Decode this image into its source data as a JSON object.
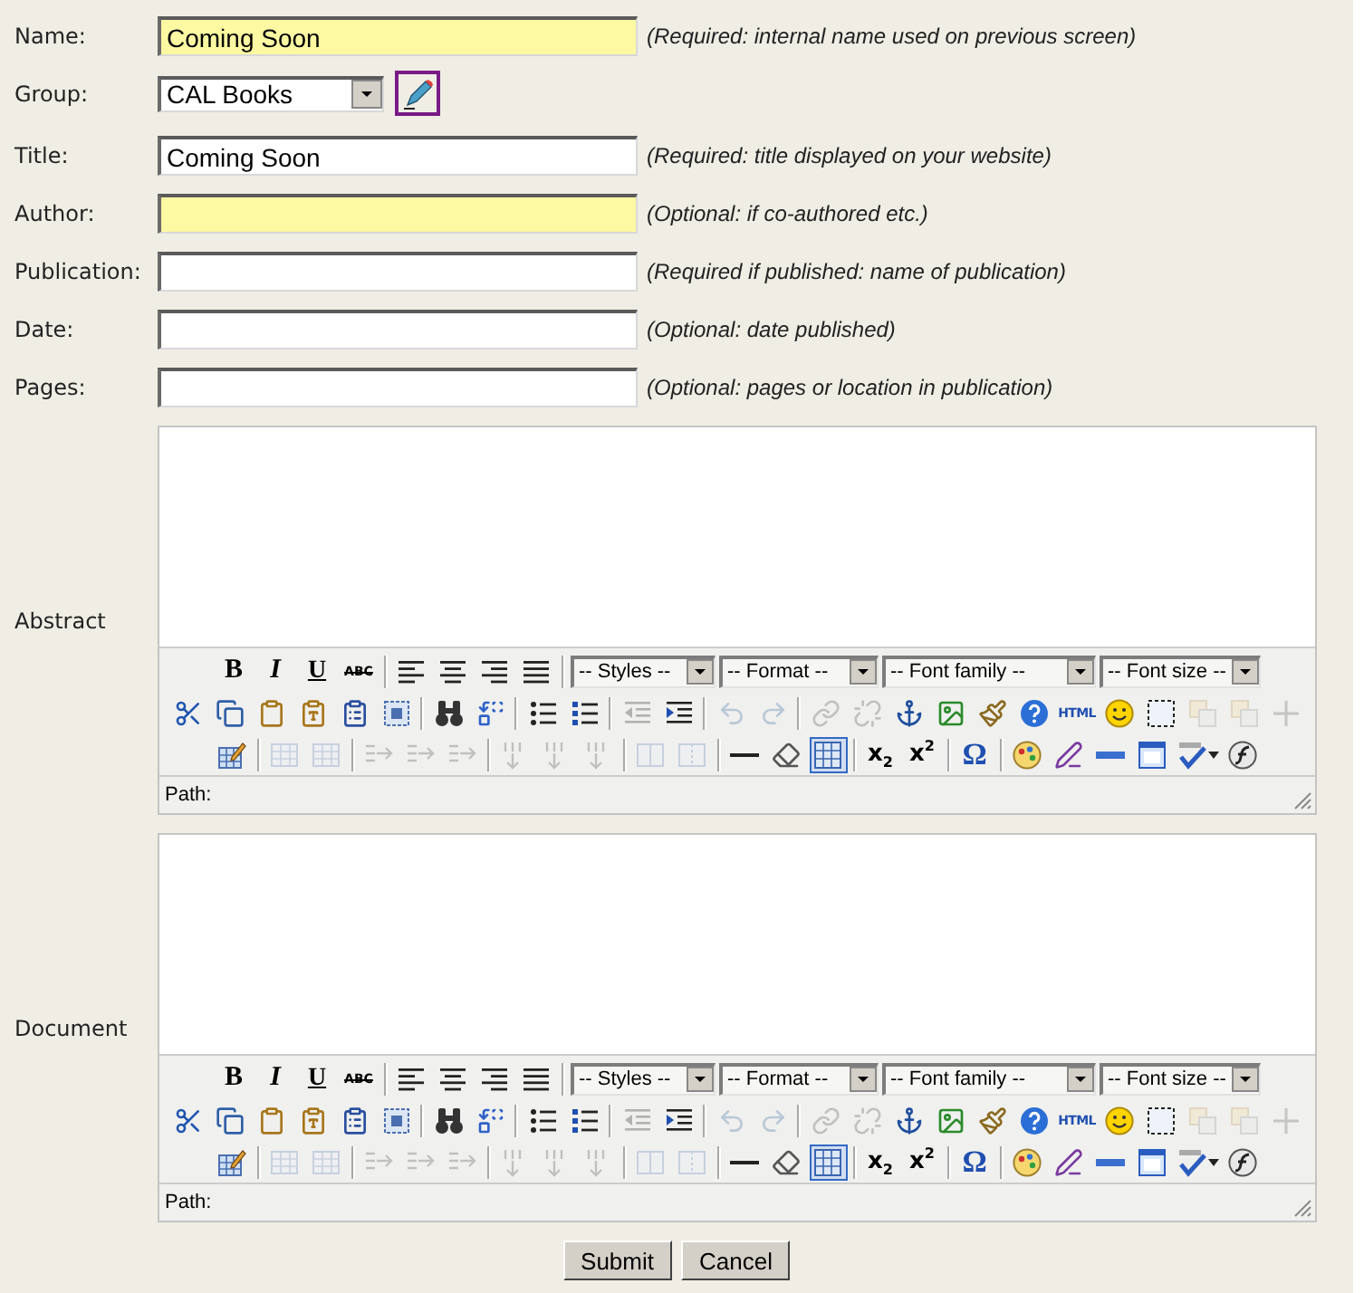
{
  "fields": [
    {
      "kind": "text",
      "label": "Name:",
      "value": "Coming Soon",
      "highlighted": true,
      "hint": "(Required: internal name used on previous screen)"
    },
    {
      "kind": "select",
      "label": "Group:",
      "value": "CAL Books"
    },
    {
      "kind": "text",
      "label": "Title:",
      "value": "Coming Soon",
      "highlighted": false,
      "hint": "(Required: title displayed on your website)"
    },
    {
      "kind": "text",
      "label": "Author:",
      "highlighted": true,
      "hint": "(Optional: if co-authored etc.)"
    },
    {
      "kind": "text",
      "label": "Publication:",
      "highlighted": false,
      "hint": "(Required if published: name of publication)"
    },
    {
      "kind": "text",
      "label": "Date:",
      "highlighted": false,
      "hint": "(Optional: date published)"
    },
    {
      "kind": "text",
      "label": "Pages:",
      "highlighted": false,
      "hint": "(Optional: pages or location in publication)"
    }
  ],
  "editors": [
    {
      "label": "Abstract",
      "toolbar": [
        [
          {
            "kind": "glyph",
            "text": "B",
            "disabled": false,
            "active": false
          },
          {
            "kind": "glyph",
            "text": "I",
            "disabled": false,
            "active": false
          },
          {
            "kind": "glyph",
            "text": "U",
            "disabled": false,
            "active": false
          },
          {
            "kind": "glyph",
            "text": "ABC",
            "disabled": false,
            "active": false
          },
          {
            "kind": "separator"
          },
          {
            "kind": "icon",
            "disabled": false,
            "active": false
          },
          {
            "kind": "icon",
            "disabled": false,
            "active": false
          },
          {
            "kind": "icon",
            "disabled": false,
            "active": false
          },
          {
            "kind": "icon",
            "disabled": false,
            "active": false
          },
          {
            "kind": "separator"
          },
          {
            "kind": "dropdown",
            "text": "-- Styles --"
          },
          {
            "kind": "dropdown",
            "text": "-- Format --"
          },
          {
            "kind": "dropdown",
            "text": "-- Font family --"
          },
          {
            "kind": "dropdown",
            "text": "-- Font size --"
          }
        ],
        [
          {
            "kind": "icon",
            "disabled": false,
            "active": false
          },
          {
            "kind": "icon",
            "disabled": false,
            "active": false
          },
          {
            "kind": "icon",
            "disabled": false,
            "active": false
          },
          {
            "kind": "icon",
            "disabled": false,
            "active": false
          },
          {
            "kind": "icon",
            "disabled": false,
            "active": false
          },
          {
            "kind": "icon",
            "disabled": false,
            "active": false
          },
          {
            "kind": "separator"
          },
          {
            "kind": "icon",
            "disabled": false,
            "active": false
          },
          {
            "kind": "icon",
            "disabled": false,
            "active": false
          },
          {
            "kind": "separator"
          },
          {
            "kind": "icon",
            "disabled": false,
            "active": false
          },
          {
            "kind": "icon",
            "disabled": false,
            "active": false
          },
          {
            "kind": "separator"
          },
          {
            "kind": "icon",
            "disabled": true,
            "active": false
          },
          {
            "kind": "icon",
            "disabled": false,
            "active": false
          },
          {
            "kind": "separator"
          },
          {
            "kind": "icon",
            "disabled": true,
            "active": false
          },
          {
            "kind": "icon",
            "disabled": true,
            "active": false
          },
          {
            "kind": "separator"
          },
          {
            "kind": "icon",
            "disabled": true,
            "active": false
          },
          {
            "kind": "icon",
            "disabled": true,
            "active": false
          },
          {
            "kind": "icon",
            "disabled": false,
            "active": false
          },
          {
            "kind": "icon",
            "disabled": false,
            "active": false
          },
          {
            "kind": "icon",
            "disabled": false,
            "active": false
          },
          {
            "kind": "icon",
            "disabled": false,
            "active": false
          },
          {
            "kind": "glyph",
            "text": "HTML",
            "disabled": false,
            "active": false
          },
          {
            "kind": "icon",
            "disabled": false,
            "active": false
          },
          {
            "kind": "icon",
            "disabled": false,
            "active": false
          },
          {
            "kind": "icon",
            "disabled": true,
            "active": false
          },
          {
            "kind": "icon",
            "disabled": true,
            "active": false
          },
          {
            "kind": "icon",
            "disabled": true,
            "active": false
          }
        ],
        [
          {
            "kind": "icon",
            "disabled": false,
            "active": false
          },
          {
            "kind": "separator"
          },
          {
            "kind": "icon",
            "disabled": true,
            "active": false
          },
          {
            "kind": "icon",
            "disabled": true,
            "active": false
          },
          {
            "kind": "separator"
          },
          {
            "kind": "icon",
            "disabled": true,
            "active": false
          },
          {
            "kind": "icon",
            "disabled": true,
            "active": false
          },
          {
            "kind": "icon",
            "disabled": true,
            "active": false
          },
          {
            "kind": "separator"
          },
          {
            "kind": "icon",
            "disabled": true,
            "active": false
          },
          {
            "kind": "icon",
            "disabled": true,
            "active": false
          },
          {
            "kind": "icon",
            "disabled": true,
            "active": false
          },
          {
            "kind": "separator"
          },
          {
            "kind": "icon",
            "disabled": true,
            "active": false
          },
          {
            "kind": "icon",
            "disabled": true,
            "active": false
          },
          {
            "kind": "separator"
          },
          {
            "kind": "icon",
            "disabled": false,
            "active": false
          },
          {
            "kind": "icon",
            "disabled": false,
            "active": false
          },
          {
            "kind": "icon",
            "disabled": false,
            "active": true
          },
          {
            "kind": "separator"
          },
          {
            "kind": "glyph",
            "text": "x$_{2}$",
            "disabled": false,
            "active": false
          },
          {
            "kind": "glyph",
            "text": "x$^{2}$",
            "disabled": false,
            "active": false
          },
          {
            "kind": "separator"
          },
          {
            "kind": "glyph",
            "text": "Ω",
            "disabled": false,
            "active": false
          },
          {
            "kind": "separator"
          },
          {
            "kind": "icon",
            "disabled": false,
            "active": false
          },
          {
            "kind": "icon",
            "disabled": false,
            "active": false
          },
          {
            "kind": "icon",
            "disabled": false,
            "active": false
          },
          {
            "kind": "icon",
            "disabled": false,
            "active": false
          },
          {
            "kind": "split",
            "disabled": false,
            "active": false
          },
          {
            "kind": "icon",
            "disabled": false,
            "active": false
          }
        ]
      ],
      "path_label": "Path:"
    },
    {
      "label": "Document",
      "toolbar": [
        [
          {
            "kind": "glyph",
            "text": "B",
            "disabled": false,
            "active": false
          },
          {
            "kind": "glyph",
            "text": "I",
            "disabled": false,
            "active": false
          },
          {
            "kind": "glyph",
            "text": "U",
            "disabled": false,
            "active": false
          },
          {
            "kind": "glyph",
            "text": "ABC",
            "disabled": false,
            "active": false
          },
          {
            "kind": "separator"
          },
          {
            "kind": "icon",
            "disabled": false,
            "active": false
          },
          {
            "kind": "icon",
            "disabled": false,
            "active": false
          },
          {
            "kind": "icon",
            "disabled": false,
            "active": false
          },
          {
            "kind": "icon",
            "disabled": false,
            "active": false
          },
          {
            "kind": "separator"
          },
          {
            "kind": "dropdown",
            "text": "-- Styles --"
          },
          {
            "kind": "dropdown",
            "text": "-- Format --"
          },
          {
            "kind": "dropdown",
            "text": "-- Font family --"
          },
          {
            "kind": "dropdown",
            "text": "-- Font size --"
          }
        ],
        [
          {
            "kind": "icon",
            "disabled": false,
            "active": false
          },
          {
            "kind": "icon",
            "disabled": false,
            "active": false
          },
          {
            "kind": "icon",
            "disabled": false,
            "active": false
          },
          {
            "kind": "icon",
            "disabled": false,
            "active": false
          },
          {
            "kind": "icon",
            "disabled": false,
            "active": false
          },
          {
            "kind": "icon",
            "disabled": false,
            "active": false
          },
          {
            "kind": "separator"
          },
          {
            "kind": "icon",
            "disabled": false,
            "active": false
          },
          {
            "kind": "icon",
            "disabled": false,
            "active": false
          },
          {
            "kind": "separator"
          },
          {
            "kind": "icon",
            "disabled": false,
            "active": false
          },
          {
            "kind": "icon",
            "disabled": false,
            "active": false
          },
          {
            "kind": "separator"
          },
          {
            "kind": "icon",
            "disabled": true,
            "active": false
          },
          {
            "kind": "icon",
            "disabled": false,
            "active": false
          },
          {
            "kind": "separator"
          },
          {
            "kind": "icon",
            "disabled": true,
            "active": false
          },
          {
            "kind": "icon",
            "disabled": true,
            "active": false
          },
          {
            "kind": "separator"
          },
          {
            "kind": "icon",
            "disabled": true,
            "active": false
          },
          {
            "kind": "icon",
            "disabled": true,
            "active": false
          },
          {
            "kind": "icon",
            "disabled": false,
            "active": false
          },
          {
            "kind": "icon",
            "disabled": false,
            "active": false
          },
          {
            "kind": "icon",
            "disabled": false,
            "active": false
          },
          {
            "kind": "icon",
            "disabled": false,
            "active": false
          },
          {
            "kind": "glyph",
            "text": "HTML",
            "disabled": false,
            "active": false
          },
          {
            "kind": "icon",
            "disabled": false,
            "active": false
          },
          {
            "kind": "icon",
            "disabled": false,
            "active": false
          },
          {
            "kind": "icon",
            "disabled": true,
            "active": false
          },
          {
            "kind": "icon",
            "disabled": true,
            "active": false
          },
          {
            "kind": "icon",
            "disabled": true,
            "active": false
          }
        ],
        [
          {
            "kind": "icon",
            "disabled": false,
            "active": false
          },
          {
            "kind": "separator"
          },
          {
            "kind": "icon",
            "disabled": true,
            "active": false
          },
          {
            "kind": "icon",
            "disabled": true,
            "active": false
          },
          {
            "kind": "separator"
          },
          {
            "kind": "icon",
            "disabled": true,
            "active": false
          },
          {
            "kind": "icon",
            "disabled": true,
            "active": false
          },
          {
            "kind": "icon",
            "disabled": true,
            "active": false
          },
          {
            "kind": "separator"
          },
          {
            "kind": "icon",
            "disabled": true,
            "active": false
          },
          {
            "kind": "icon",
            "disabled": true,
            "active": false
          },
          {
            "kind": "icon",
            "disabled": true,
            "active": false
          },
          {
            "kind": "separator"
          },
          {
            "kind": "icon",
            "disabled": true,
            "active": false
          },
          {
            "kind": "icon",
            "disabled": true,
            "active": false
          },
          {
            "kind": "separator"
          },
          {
            "kind": "icon",
            "disabled": false,
            "active": false
          },
          {
            "kind": "icon",
            "disabled": false,
            "active": false
          },
          {
            "kind": "icon",
            "disabled": false,
            "active": true
          },
          {
            "kind": "separator"
          },
          {
            "kind": "glyph",
            "text": "x$_{2}$",
            "disabled": false,
            "active": false
          },
          {
            "kind": "glyph",
            "text": "x$^{2}$",
            "disabled": false,
            "active": false
          },
          {
            "kind": "separator"
          },
          {
            "kind": "glyph",
            "text": "Ω",
            "disabled": false,
            "active": false
          },
          {
            "kind": "separator"
          },
          {
            "kind": "icon",
            "disabled": false,
            "active": false
          },
          {
            "kind": "icon",
            "disabled": false,
            "active": false
          },
          {
            "kind": "icon",
            "disabled": false,
            "active": false
          },
          {
            "kind": "icon",
            "disabled": false,
            "active": false
          },
          {
            "kind": "split",
            "disabled": false,
            "active": false
          },
          {
            "kind": "icon",
            "disabled": false,
            "active": false
          }
        ]
      ],
      "path_label": "Path:"
    }
  ],
  "buttons": [
    "Submit",
    "Cancel"
  ]
}
